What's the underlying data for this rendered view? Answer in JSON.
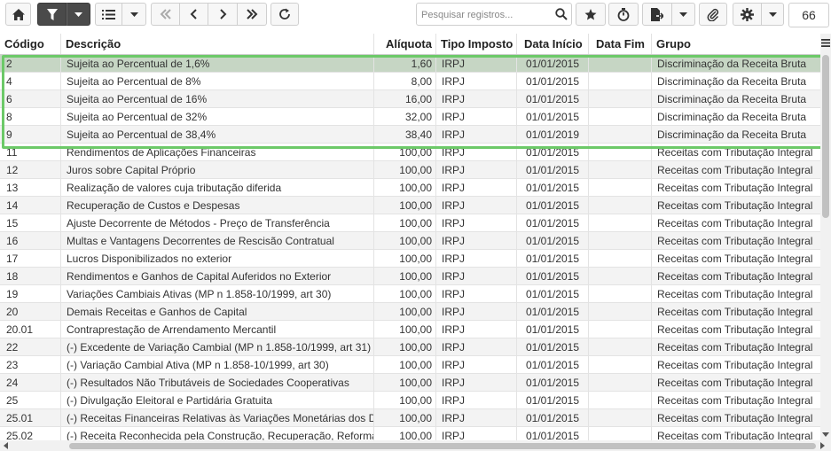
{
  "toolbar": {
    "search_placeholder": "Pesquisar registros...",
    "page_size": "66",
    "icons": [
      "home-icon",
      "filter-icon",
      "caret-down-icon",
      "list-icon",
      "caret-down-icon",
      "first-page-icon",
      "prev-page-icon",
      "next-page-icon",
      "last-page-icon",
      "refresh-icon",
      "search-icon",
      "star-icon",
      "stopwatch-icon",
      "export-file-icon",
      "caret-down-icon",
      "paperclip-icon",
      "gear-icon",
      "caret-down-icon"
    ]
  },
  "columns": {
    "codigo": "Código",
    "descricao": "Descrição",
    "aliquota": "Alíquota",
    "tipo": "Tipo Imposto",
    "inicio": "Data Início",
    "fim": "Data Fim",
    "grupo": "Grupo"
  },
  "rows": [
    {
      "codigo": "2",
      "descricao": "Sujeita ao Percentual de 1,6%",
      "aliquota": "1,60",
      "tipo": "IRPJ",
      "inicio": "01/01/2015",
      "fim": "",
      "grupo": "Discriminação da Receita Bruta"
    },
    {
      "codigo": "4",
      "descricao": "Sujeita ao Percentual de 8%",
      "aliquota": "8,00",
      "tipo": "IRPJ",
      "inicio": "01/01/2015",
      "fim": "",
      "grupo": "Discriminação da Receita Bruta"
    },
    {
      "codigo": "6",
      "descricao": "Sujeita ao Percentual de 16%",
      "aliquota": "16,00",
      "tipo": "IRPJ",
      "inicio": "01/01/2015",
      "fim": "",
      "grupo": "Discriminação da Receita Bruta"
    },
    {
      "codigo": "8",
      "descricao": "Sujeita ao Percentual de 32%",
      "aliquota": "32,00",
      "tipo": "IRPJ",
      "inicio": "01/01/2015",
      "fim": "",
      "grupo": "Discriminação da Receita Bruta"
    },
    {
      "codigo": "9",
      "descricao": "Sujeita ao Percentual de 38,4%",
      "aliquota": "38,40",
      "tipo": "IRPJ",
      "inicio": "01/01/2019",
      "fim": "",
      "grupo": "Discriminação da Receita Bruta"
    },
    {
      "codigo": "11",
      "descricao": "Rendimentos de Aplicações Financeiras",
      "aliquota": "100,00",
      "tipo": "IRPJ",
      "inicio": "01/01/2015",
      "fim": "",
      "grupo": "Receitas com Tributação Integral"
    },
    {
      "codigo": "12",
      "descricao": "Juros sobre Capital Próprio",
      "aliquota": "100,00",
      "tipo": "IRPJ",
      "inicio": "01/01/2015",
      "fim": "",
      "grupo": "Receitas com Tributação Integral"
    },
    {
      "codigo": "13",
      "descricao": "Realização de valores cuja tributação diferida",
      "aliquota": "100,00",
      "tipo": "IRPJ",
      "inicio": "01/01/2015",
      "fim": "",
      "grupo": "Receitas com Tributação Integral"
    },
    {
      "codigo": "14",
      "descricao": "Recuperação de Custos e Despesas",
      "aliquota": "100,00",
      "tipo": "IRPJ",
      "inicio": "01/01/2015",
      "fim": "",
      "grupo": "Receitas com Tributação Integral"
    },
    {
      "codigo": "15",
      "descricao": "Ajuste Decorrente de Métodos - Preço de Transferência",
      "aliquota": "100,00",
      "tipo": "IRPJ",
      "inicio": "01/01/2015",
      "fim": "",
      "grupo": "Receitas com Tributação Integral"
    },
    {
      "codigo": "16",
      "descricao": "Multas e Vantagens Decorrentes de Rescisão Contratual",
      "aliquota": "100,00",
      "tipo": "IRPJ",
      "inicio": "01/01/2015",
      "fim": "",
      "grupo": "Receitas com Tributação Integral"
    },
    {
      "codigo": "17",
      "descricao": "Lucros Disponibilizados no exterior",
      "aliquota": "100,00",
      "tipo": "IRPJ",
      "inicio": "01/01/2015",
      "fim": "",
      "grupo": "Receitas com Tributação Integral"
    },
    {
      "codigo": "18",
      "descricao": "Rendimentos e Ganhos de Capital Auferidos no Exterior",
      "aliquota": "100,00",
      "tipo": "IRPJ",
      "inicio": "01/01/2015",
      "fim": "",
      "grupo": "Receitas com Tributação Integral"
    },
    {
      "codigo": "19",
      "descricao": "Variações Cambiais Ativas (MP n 1.858-10/1999, art 30)",
      "aliquota": "100,00",
      "tipo": "IRPJ",
      "inicio": "01/01/2015",
      "fim": "",
      "grupo": "Receitas com Tributação Integral"
    },
    {
      "codigo": "20",
      "descricao": "Demais Receitas e Ganhos de Capital",
      "aliquota": "100,00",
      "tipo": "IRPJ",
      "inicio": "01/01/2015",
      "fim": "",
      "grupo": "Receitas com Tributação Integral"
    },
    {
      "codigo": "20.01",
      "descricao": "Contraprestação de Arrendamento Mercantil",
      "aliquota": "100,00",
      "tipo": "IRPJ",
      "inicio": "01/01/2015",
      "fim": "",
      "grupo": "Receitas com Tributação Integral"
    },
    {
      "codigo": "22",
      "descricao": "(-) Excedente de Variação Cambial (MP n 1.858-10/1999, art 31)",
      "aliquota": "100,00",
      "tipo": "IRPJ",
      "inicio": "01/01/2015",
      "fim": "",
      "grupo": "Receitas com Tributação Integral"
    },
    {
      "codigo": "23",
      "descricao": "(-) Variação Cambial Ativa (MP n 1.858-10/1999, art 30)",
      "aliquota": "100,00",
      "tipo": "IRPJ",
      "inicio": "01/01/2015",
      "fim": "",
      "grupo": "Receitas com Tributação Integral"
    },
    {
      "codigo": "24",
      "descricao": "(-) Resultados Não Tributáveis de Sociedades Cooperativas",
      "aliquota": "100,00",
      "tipo": "IRPJ",
      "inicio": "01/01/2015",
      "fim": "",
      "grupo": "Receitas com Tributação Integral"
    },
    {
      "codigo": "25",
      "descricao": "(-) Divulgação Eleitoral e Partidária Gratuita",
      "aliquota": "100,00",
      "tipo": "IRPJ",
      "inicio": "01/01/2015",
      "fim": "",
      "grupo": "Receitas com Tributação Integral"
    },
    {
      "codigo": "25.01",
      "descricao": "(-) Receitas Financeiras Relativas às Variações Monetárias dos Direitos",
      "aliquota": "100,00",
      "tipo": "IRPJ",
      "inicio": "01/01/2015",
      "fim": "",
      "grupo": "Receitas com Tributação Integral"
    },
    {
      "codigo": "25.02",
      "descricao": "(-) Receita Reconhecida pela Construção, Recuperação, Reforma",
      "aliquota": "100,00",
      "tipo": "IRPJ",
      "inicio": "01/01/2015",
      "fim": "",
      "grupo": "Receitas com Tributação Integral"
    }
  ],
  "selected_row": "2",
  "colors": {
    "highlight": "#6cc968",
    "selected_row": "#c6d6c4",
    "toolbar_dark": "#4a4a4a"
  }
}
